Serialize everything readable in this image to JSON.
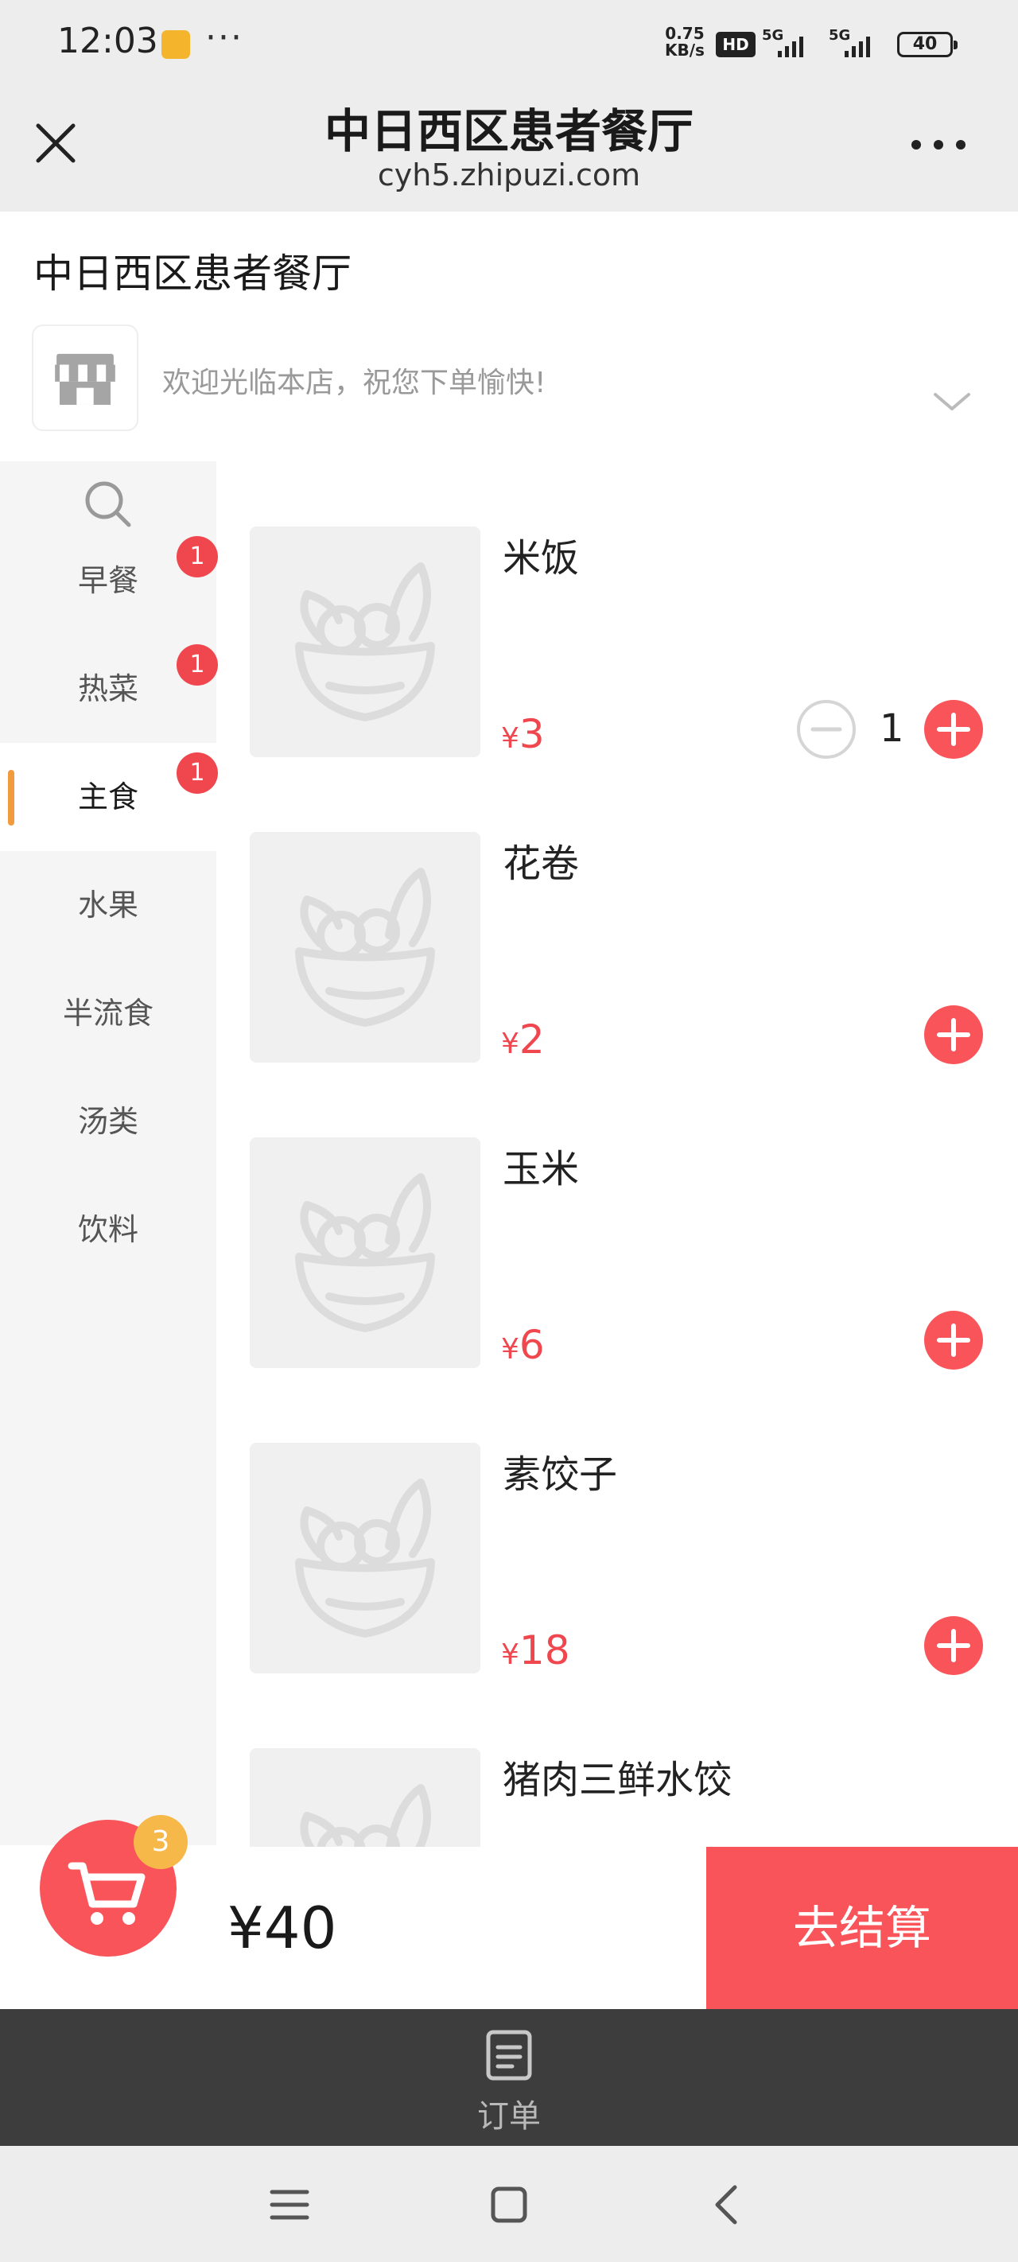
{
  "status_bar": {
    "time": "12:03",
    "net_speed_value": "0.75",
    "net_speed_unit": "KB/s",
    "hd_label": "HD",
    "signal1_label": "5G",
    "signal2_label": "5G",
    "battery": "40"
  },
  "titlebar": {
    "title": "中日西区患者餐厅",
    "url": "cyh5.zhipuzi.com",
    "close_icon": "close-icon",
    "more_icon": "more-horizontal-icon"
  },
  "store": {
    "name": "中日西区患者餐厅",
    "welcome": "欢迎光临本店，祝您下单愉快!",
    "logo_icon": "storefront-icon"
  },
  "sidebar": {
    "search_icon": "search-icon",
    "categories": [
      {
        "label": "早餐",
        "badge": "1",
        "active": false
      },
      {
        "label": "热菜",
        "badge": "1",
        "active": false
      },
      {
        "label": "主食",
        "badge": "1",
        "active": true
      },
      {
        "label": "水果",
        "badge": "",
        "active": false
      },
      {
        "label": "半流食",
        "badge": "",
        "active": false
      },
      {
        "label": "汤类",
        "badge": "",
        "active": false
      },
      {
        "label": "饮料",
        "badge": "",
        "active": false
      }
    ]
  },
  "products": [
    {
      "name": "米饭",
      "currency": "¥",
      "price": "3",
      "qty": "1"
    },
    {
      "name": "花卷",
      "currency": "¥",
      "price": "2",
      "qty": ""
    },
    {
      "name": "玉米",
      "currency": "¥",
      "price": "6",
      "qty": ""
    },
    {
      "name": "素饺子",
      "currency": "¥",
      "price": "18",
      "qty": ""
    },
    {
      "name": "猪肉三鲜水饺",
      "currency": "",
      "price": "",
      "qty": ""
    }
  ],
  "cart": {
    "count": "3",
    "total": "¥40",
    "checkout_label": "去结算",
    "cart_icon": "shopping-cart-icon"
  },
  "tabbar": {
    "orders_label": "订单",
    "orders_icon": "document-icon"
  },
  "colors": {
    "accent_red": "#f9545a",
    "price_red": "#f0474f",
    "badge_orange": "#f7b84a",
    "active_indicator": "#f29b3e"
  }
}
